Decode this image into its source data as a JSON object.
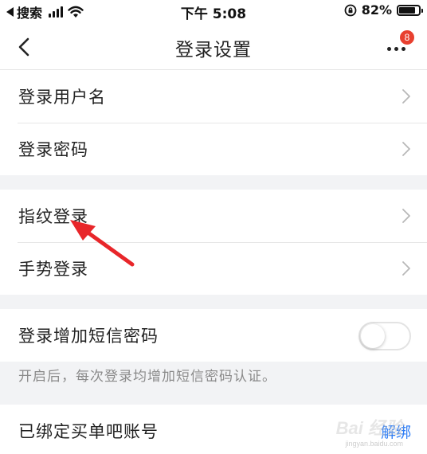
{
  "status_bar": {
    "back_app": "搜索",
    "time": "下午 5:08",
    "battery_percent": "82%",
    "battery_level": 0.82,
    "icons": [
      "back-triangle-icon",
      "signal-icon",
      "wifi-icon",
      "rotation-lock-icon",
      "battery-icon"
    ]
  },
  "nav": {
    "title": "登录设置",
    "badge_count": "8",
    "icons": [
      "back-chevron-icon",
      "more-dots-icon"
    ]
  },
  "groups": [
    {
      "items": [
        {
          "label": "登录用户名"
        },
        {
          "label": "登录密码"
        }
      ]
    },
    {
      "items": [
        {
          "label": "指纹登录"
        },
        {
          "label": "手势登录"
        }
      ]
    }
  ],
  "sms_setting": {
    "label": "登录增加短信密码",
    "enabled": false,
    "hint": "开启后，每次登录均增加短信密码认证。"
  },
  "bound_account": {
    "label": "已绑定买单吧账号",
    "action": "解绑"
  },
  "watermark": {
    "text": "Bai 经验",
    "sub": "jingyan.baidu.com"
  },
  "colors": {
    "background": "#f2f3f5",
    "badge": "#e8402f",
    "link": "#2d7df6",
    "annotation_arrow": "#e8262a"
  }
}
